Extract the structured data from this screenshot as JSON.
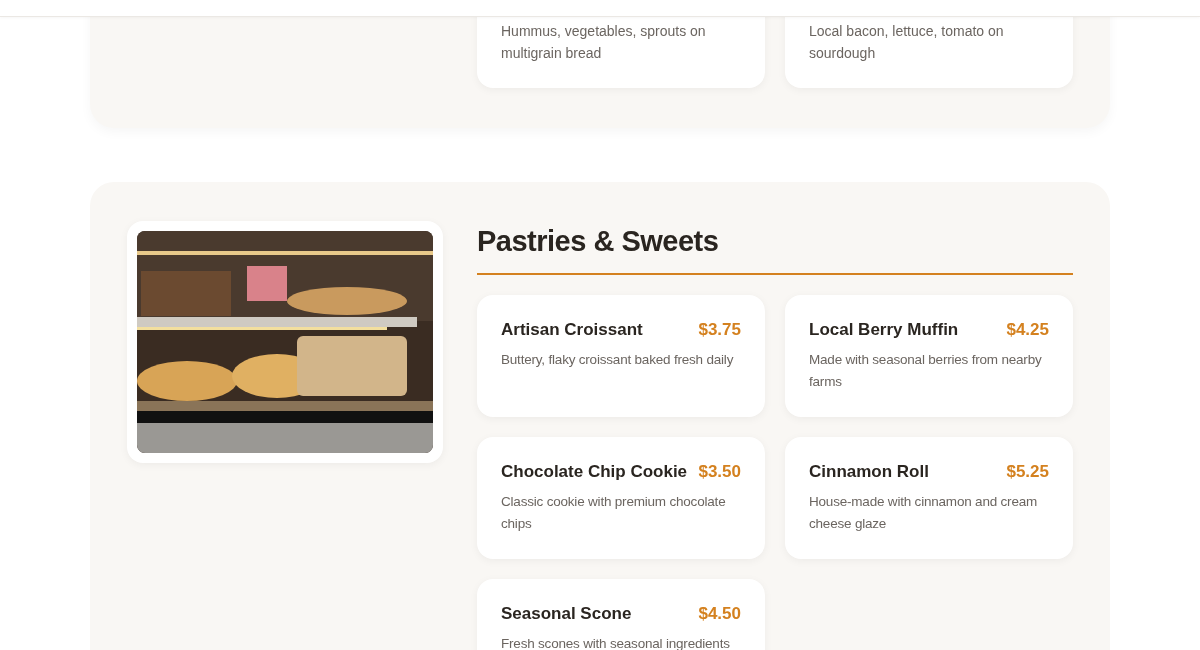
{
  "previous_section": {
    "items": [
      {
        "description": "Hummus, vegetables, sprouts on multigrain bread"
      },
      {
        "description": "Local bacon, lettuce, tomato on sourdough"
      }
    ]
  },
  "pastries": {
    "title": "Pastries & Sweets",
    "items": [
      {
        "name": "Artisan Croissant",
        "price": "$3.75",
        "description": "Buttery, flaky croissant baked fresh daily"
      },
      {
        "name": "Local Berry Muffin",
        "price": "$4.25",
        "description": "Made with seasonal berries from nearby farms"
      },
      {
        "name": "Chocolate Chip Cookie",
        "price": "$3.50",
        "description": "Classic cookie with premium chocolate chips"
      },
      {
        "name": "Cinnamon Roll",
        "price": "$5.25",
        "description": "House-made with cinnamon and cream cheese glaze"
      },
      {
        "name": "Seasonal Scone",
        "price": "$4.50",
        "description": "Fresh scones with seasonal ingredients"
      }
    ]
  }
}
